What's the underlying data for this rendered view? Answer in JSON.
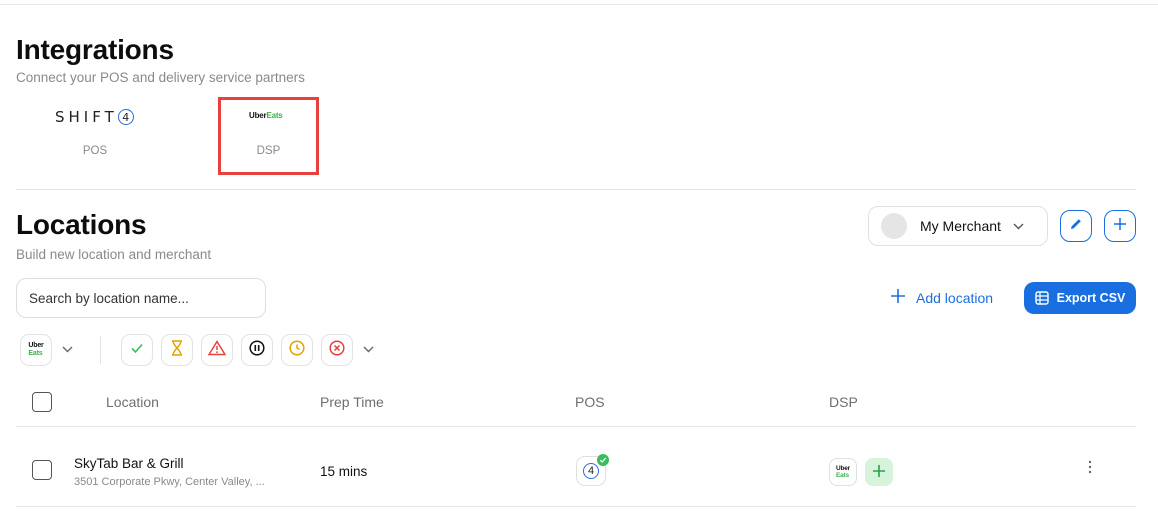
{
  "integrations": {
    "title": "Integrations",
    "subtitle": "Connect your POS and delivery service partners",
    "partners": [
      {
        "logo_text": "SHIFT",
        "logo_badge": "4",
        "type": "POS"
      },
      {
        "logo_text_1": "Uber",
        "logo_text_2": "Eats",
        "type": "DSP"
      }
    ]
  },
  "locations": {
    "title": "Locations",
    "subtitle": "Build new location and merchant",
    "merchant_select": {
      "value": "My Merchant"
    },
    "search": {
      "placeholder": "Search by location name..."
    },
    "add_location_label": "Add location",
    "export_label": "Export CSV",
    "filter_dsp": {
      "logo_1": "Uber",
      "logo_2": "Eats"
    },
    "status_filters": [
      "check-icon",
      "hourglass-icon",
      "warning-icon",
      "pause-icon",
      "clock-icon",
      "error-icon"
    ],
    "table": {
      "columns": [
        "Location",
        "Prep Time",
        "POS",
        "DSP"
      ],
      "rows": [
        {
          "name": "SkyTab Bar & Grill",
          "address": "3501 Corporate Pkwy, Center Valley, ...",
          "prep_time": "15 mins",
          "pos_badge": "4",
          "dsp_logo_1": "Uber",
          "dsp_logo_2": "Eats"
        }
      ]
    }
  },
  "colors": {
    "accent": "#1a6fe0",
    "highlight": "#e8413f",
    "uber_green": "#3fb04a"
  }
}
